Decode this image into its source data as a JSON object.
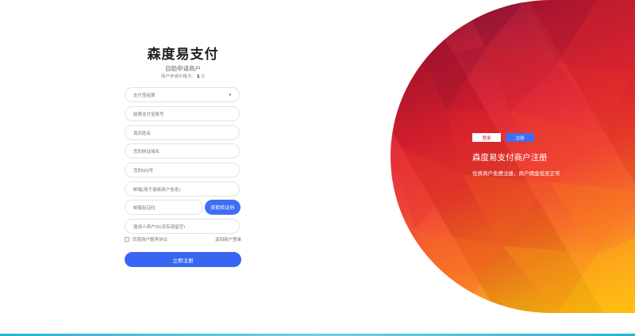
{
  "form": {
    "title": "森度易支付",
    "subtitle": "自助申请商户",
    "price_prefix": "商户申请价格为：",
    "price_value": "1",
    "price_unit": "元",
    "settle_select": {
      "selected": "支付宝结算",
      "caret": "▾"
    },
    "account_placeholder": "结算支付宝账号",
    "name_placeholder": "真实姓名",
    "website_placeholder": "您的网站域名",
    "qq_placeholder": "您的QQ号",
    "email_placeholder": "邮箱(用于接收商户信息)",
    "code_placeholder": "邮箱验证码",
    "get_code_label": "获取验证码",
    "invite_placeholder": "邀请人商户ID(没有请留空)",
    "agree_label": "同意商户服务协议",
    "login_link": "返回商户登录",
    "submit_label": "立即注册"
  },
  "hero": {
    "tab_login": "登录",
    "tab_register": "注册",
    "title": "森度易支付商户注册",
    "subtitle": "优质商户免费注册，商户佣金低至正常"
  },
  "colors": {
    "accent": "#3f6ef5",
    "hero_dark": "#7d0b2a",
    "hero_red": "#e0202f",
    "hero_yellow": "#ffc40b"
  }
}
